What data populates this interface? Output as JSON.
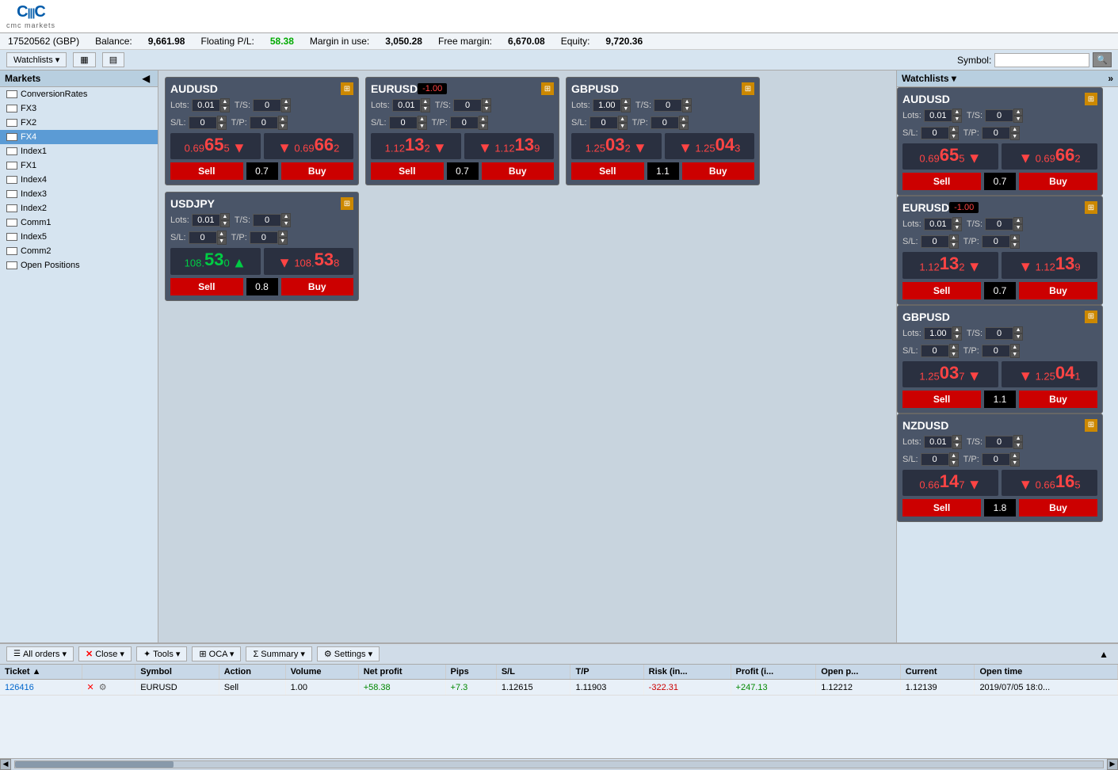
{
  "logo": {
    "main": "CIMC",
    "sub": "cmc markets"
  },
  "account": {
    "id": "17520562 (GBP)",
    "balance_label": "Balance:",
    "balance": "9,661.98",
    "floating_label": "Floating P/L:",
    "floating": "58.38",
    "margin_label": "Margin in use:",
    "margin": "3,050.28",
    "free_margin_label": "Free margin:",
    "free_margin": "6,670.08",
    "equity_label": "Equity:",
    "equity": "9,720.36"
  },
  "toolbar": {
    "watchlists_label": "Watchlists ▾",
    "symbol_label": "Symbol:",
    "symbol_placeholder": ""
  },
  "sidebar": {
    "title": "Markets",
    "items": [
      {
        "label": "ConversionRates",
        "selected": false
      },
      {
        "label": "FX3",
        "selected": false
      },
      {
        "label": "FX2",
        "selected": false
      },
      {
        "label": "FX4",
        "selected": true
      },
      {
        "label": "Index1",
        "selected": false
      },
      {
        "label": "FX1",
        "selected": false
      },
      {
        "label": "Index4",
        "selected": false
      },
      {
        "label": "Index3",
        "selected": false
      },
      {
        "label": "Index2",
        "selected": false
      },
      {
        "label": "Comm1",
        "selected": false
      },
      {
        "label": "Index5",
        "selected": false
      },
      {
        "label": "Comm2",
        "selected": false
      },
      {
        "label": "Open Positions",
        "selected": false
      }
    ]
  },
  "cards": [
    {
      "symbol": "AUDUSD",
      "badge": "",
      "lots": "0.01",
      "ts": "0",
      "sl": "0",
      "tp": "0",
      "sell_price_prefix": "0.69",
      "sell_price_main": "65",
      "sell_price_suffix": "5",
      "sell_direction": "down",
      "buy_price_prefix": "0.69",
      "buy_price_main": "66",
      "buy_price_suffix": "2",
      "buy_direction": "down",
      "spread": "0.7",
      "sell_label": "Sell",
      "buy_label": "Buy"
    },
    {
      "symbol": "EURUSD",
      "badge": "-1.00",
      "lots": "0.01",
      "ts": "0",
      "sl": "0",
      "tp": "0",
      "sell_price_prefix": "1.12",
      "sell_price_main": "13",
      "sell_price_suffix": "2",
      "sell_direction": "down",
      "buy_price_prefix": "1.12",
      "buy_price_main": "13",
      "buy_price_suffix": "9",
      "buy_direction": "down",
      "spread": "0.7",
      "sell_label": "Sell",
      "buy_label": "Buy"
    },
    {
      "symbol": "GBPUSD",
      "badge": "",
      "lots": "1.00",
      "ts": "0",
      "sl": "0",
      "tp": "0",
      "sell_price_prefix": "1.25",
      "sell_price_main": "03",
      "sell_price_suffix": "2",
      "sell_direction": "down",
      "buy_price_prefix": "1.25",
      "buy_price_main": "04",
      "buy_price_suffix": "3",
      "buy_direction": "down",
      "spread": "1.1",
      "sell_label": "Sell",
      "buy_label": "Buy"
    },
    {
      "symbol": "USDJPY",
      "badge": "",
      "lots": "0.01",
      "ts": "0",
      "sl": "0",
      "tp": "0",
      "sell_price_prefix": "108.",
      "sell_price_main": "53",
      "sell_price_suffix": "0",
      "sell_direction": "up",
      "buy_price_prefix": "108.",
      "buy_price_main": "53",
      "buy_price_suffix": "8",
      "buy_direction": "down",
      "spread": "0.8",
      "sell_label": "Sell",
      "buy_label": "Buy"
    }
  ],
  "right_watchlist": {
    "title": "Watchlists ▾",
    "cards": [
      {
        "symbol": "AUDUSD",
        "badge": "",
        "lots": "0.01",
        "ts": "0",
        "sl": "0",
        "tp": "0",
        "sell_price_prefix": "0.69",
        "sell_price_main": "65",
        "sell_price_suffix": "5",
        "sell_direction": "down",
        "buy_price_prefix": "0.69",
        "buy_price_main": "66",
        "buy_price_suffix": "2",
        "buy_direction": "down",
        "spread": "0.7",
        "sell_label": "Sell",
        "buy_label": "Buy"
      },
      {
        "symbol": "EURUSD",
        "badge": "-1.00",
        "lots": "0.01",
        "ts": "0",
        "sl": "0",
        "tp": "0",
        "sell_price_prefix": "1.12",
        "sell_price_main": "13",
        "sell_price_suffix": "2",
        "sell_direction": "down",
        "buy_price_prefix": "1.12",
        "buy_price_main": "13",
        "buy_price_suffix": "9",
        "buy_direction": "down",
        "spread": "0.7",
        "sell_label": "Sell",
        "buy_label": "Buy"
      },
      {
        "symbol": "GBPUSD",
        "badge": "",
        "lots": "1.00",
        "ts": "0",
        "sl": "0",
        "tp": "0",
        "sell_price_prefix": "1.25",
        "sell_price_main": "03",
        "sell_price_suffix": "7",
        "sell_direction": "down",
        "buy_price_prefix": "1.25",
        "buy_price_main": "04",
        "buy_price_suffix": "1",
        "buy_direction": "down",
        "spread": "1.1",
        "sell_label": "Sell",
        "buy_label": "Buy"
      },
      {
        "symbol": "NZDUSD",
        "badge": "",
        "lots": "0.01",
        "ts": "0",
        "sl": "0",
        "tp": "0",
        "sell_price_prefix": "0.66",
        "sell_price_main": "14",
        "sell_price_suffix": "7",
        "sell_direction": "down",
        "buy_price_prefix": "0.66",
        "buy_price_main": "16",
        "buy_price_suffix": "5",
        "buy_direction": "down",
        "spread": "1.8",
        "sell_label": "Sell",
        "buy_label": "Buy"
      }
    ]
  },
  "bottom_toolbar": {
    "all_orders_label": "All orders ▾",
    "close_label": "Close ▾",
    "tools_label": "Tools ▾",
    "oca_label": "OCA ▾",
    "summary_label": "Summary ▾",
    "settings_label": "Settings ▾"
  },
  "table": {
    "columns": [
      "Ticket ▲",
      "",
      "Symbol",
      "Action",
      "Volume",
      "Net profit",
      "Pips",
      "S/L",
      "T/P",
      "Risk (in...",
      "Profit (i...",
      "Open p...",
      "Current",
      "Open time"
    ],
    "rows": [
      {
        "ticket": "126416",
        "has_close": true,
        "has_settings": true,
        "symbol": "EURUSD",
        "action": "Sell",
        "volume": "1.00",
        "net_profit": "+58.38",
        "pips": "+7.3",
        "sl": "1.12615",
        "tp": "1.11903",
        "risk": "-322.31",
        "profit": "+247.13",
        "open_p": "1.12212",
        "current": "1.12139",
        "open_time": "2019/07/05 18:0..."
      }
    ]
  }
}
